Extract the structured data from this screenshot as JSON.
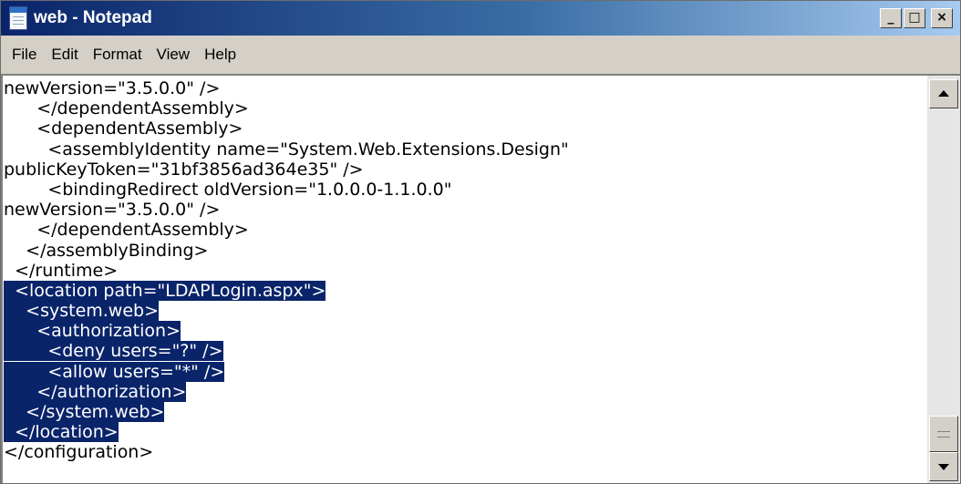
{
  "window": {
    "title": "web - Notepad",
    "controls": {
      "minimize": "_",
      "maximize": "□",
      "close": "×"
    }
  },
  "menu": [
    "File",
    "Edit",
    "Format",
    "View",
    "Help"
  ],
  "editor": {
    "lines": [
      {
        "pre": "newVersion=\"3.5.0.0\" />",
        "sel": ""
      },
      {
        "pre": "      </dependentAssembly>",
        "sel": ""
      },
      {
        "pre": "      <dependentAssembly>",
        "sel": ""
      },
      {
        "pre": "        <assemblyIdentity name=\"System.Web.Extensions.Design\"",
        "sel": ""
      },
      {
        "pre": "publicKeyToken=\"31bf3856ad364e35\" />",
        "sel": ""
      },
      {
        "pre": "        <bindingRedirect oldVersion=\"1.0.0.0-1.1.0.0\"",
        "sel": ""
      },
      {
        "pre": "newVersion=\"3.5.0.0\" />",
        "sel": ""
      },
      {
        "pre": "      </dependentAssembly>",
        "sel": ""
      },
      {
        "pre": "    </assemblyBinding>",
        "sel": ""
      },
      {
        "pre": "  </runtime>",
        "sel": ""
      },
      {
        "pre": "",
        "sel": "  <location path=\"LDAPLogin.aspx\">"
      },
      {
        "pre": "",
        "sel": "    <system.web>"
      },
      {
        "pre": "",
        "sel": "      <authorization>"
      },
      {
        "pre": "",
        "sel": "        <deny users=\"?\" />"
      },
      {
        "pre": "",
        "sel": "        <allow users=\"*\" />"
      },
      {
        "pre": "",
        "sel": "      </authorization>"
      },
      {
        "pre": "",
        "sel": "    </system.web>"
      },
      {
        "pre": "",
        "sel": "  </location>"
      },
      {
        "pre": "</configuration>",
        "sel": ""
      }
    ]
  },
  "colors": {
    "selection_bg": "#0a246a",
    "selection_fg": "#ffffff",
    "titlebar_start": "#0a246a",
    "titlebar_end": "#a6caf0",
    "chrome": "#d4d0c8"
  },
  "icons": {
    "app": "notepad-icon",
    "minimize": "minimize-icon",
    "maximize": "maximize-icon",
    "close": "close-icon",
    "scroll_up": "scroll-up-arrow-icon",
    "scroll_down": "scroll-down-arrow-icon"
  }
}
